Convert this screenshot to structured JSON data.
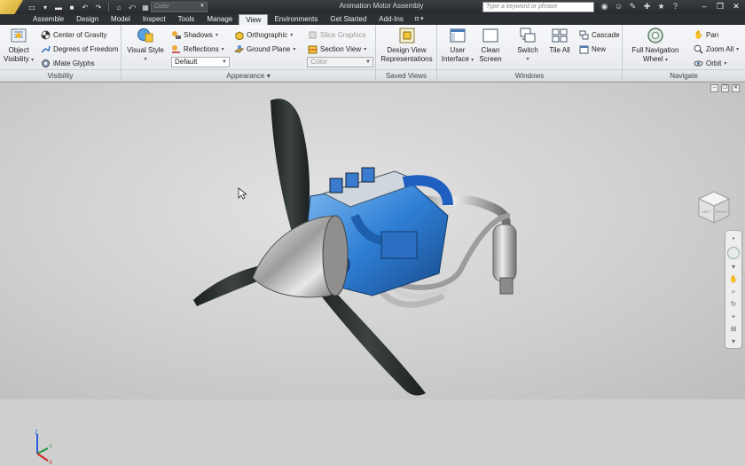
{
  "titlebar": {
    "app_title": "Animation Motor Assembly",
    "color_combo": "Color",
    "search_placeholder": "Type a keyword or phrase"
  },
  "qat_icons": [
    "folder-icon",
    "open-icon",
    "save-icon",
    "undo-icon",
    "redo-icon",
    "home-icon",
    "return-icon"
  ],
  "title_icons": [
    "binoculars-icon",
    "user-icon",
    "wrench-icon",
    "favorites-icon",
    "star-icon",
    "help-icon"
  ],
  "window_controls": [
    "minimize-icon",
    "restore-icon",
    "close-icon"
  ],
  "tabs": [
    {
      "label": "Assemble",
      "active": false
    },
    {
      "label": "Design",
      "active": false
    },
    {
      "label": "Model",
      "active": false
    },
    {
      "label": "Inspect",
      "active": false
    },
    {
      "label": "Tools",
      "active": false
    },
    {
      "label": "Manage",
      "active": false
    },
    {
      "label": "View",
      "active": true
    },
    {
      "label": "Environments",
      "active": false
    },
    {
      "label": "Get Started",
      "active": false
    },
    {
      "label": "Add-Ins",
      "active": false
    }
  ],
  "tab_extra": "◘ ▾",
  "ribbon": {
    "visibility": {
      "label": "Visibility",
      "object_visibility": [
        "Object",
        "Visibility"
      ],
      "center_of_gravity": "Center of Gravity",
      "degrees_of_freedom": "Degrees of Freedom",
      "imate_glyphs": "iMate Glyphs"
    },
    "appearance": {
      "label": "Appearance",
      "label_arrow": "▾",
      "visual_style": "Visual Style",
      "shadows": "Shadows",
      "reflections": "Reflections",
      "orthographic": "Orthographic",
      "ground_plane": "Ground Plane",
      "default_combo": "Default",
      "slice_graphics": "Slice Graphics",
      "section_view": "Section View",
      "color_combo": "Color"
    },
    "saved_views": {
      "label": "Saved Views",
      "design_view": [
        "Design View",
        "Representations"
      ]
    },
    "windows": {
      "label": "Windows",
      "user_interface": [
        "User",
        "Interface"
      ],
      "clean_screen": [
        "Clean",
        "Screen"
      ],
      "switch": "Switch",
      "tile_all": "Tile All",
      "cascade": "Cascade",
      "new": "New"
    },
    "navigate": {
      "label": "Navigate",
      "full_nav_wheel": [
        "Full Navigation",
        "Wheel"
      ],
      "pan": "Pan",
      "zoom_all": "Zoom All",
      "orbit": "Orbit"
    }
  },
  "viewport": {
    "viewcube_faces": [
      "LEFT",
      "FRONT"
    ],
    "triad_axes": [
      "Z",
      "Y",
      "X"
    ]
  },
  "colors": {
    "engine_blue": "#2f7fd6",
    "blade": "#2b2f2f",
    "chrome": "#bdbdbd",
    "active_tab": "#eef1f5"
  }
}
